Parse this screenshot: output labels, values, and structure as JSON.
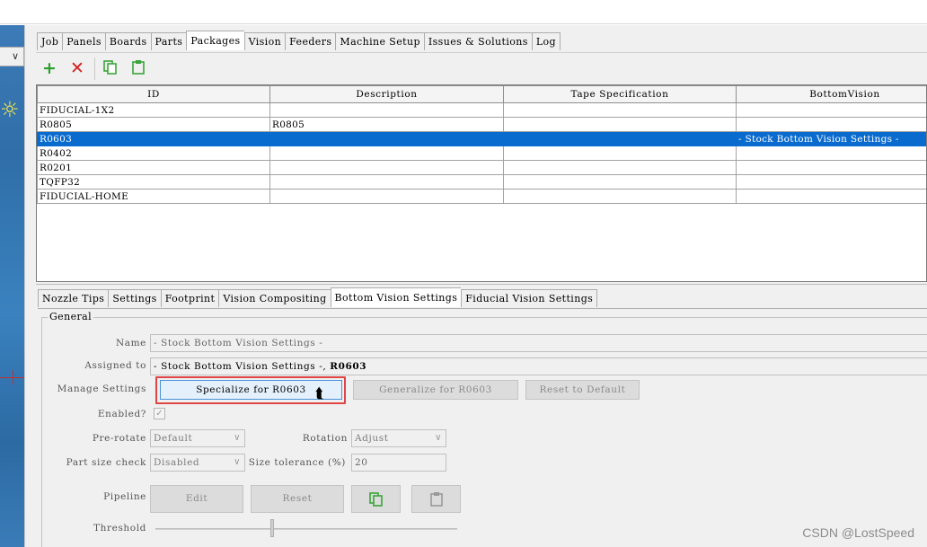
{
  "main_tabs": [
    "Job",
    "Panels",
    "Boards",
    "Parts",
    "Packages",
    "Vision",
    "Feeders",
    "Machine Setup",
    "Issues & Solutions",
    "Log"
  ],
  "active_main_tab": "Packages",
  "toolbar": {
    "add_icon": "plus-icon",
    "delete_icon": "delete-icon",
    "copy_icon": "copy-icon",
    "paste_icon": "paste-icon"
  },
  "table": {
    "columns": [
      "ID",
      "Description",
      "Tape Specification",
      "BottomVision"
    ],
    "rows": [
      [
        "FIDUCIAL-1X2",
        "",
        "",
        ""
      ],
      [
        "R0805",
        "R0805",
        "",
        ""
      ],
      [
        "R0603",
        "",
        "",
        "- Stock Bottom Vision Settings -"
      ],
      [
        "R0402",
        "",
        "",
        ""
      ],
      [
        "R0201",
        "",
        "",
        ""
      ],
      [
        "TQFP32",
        "",
        "",
        ""
      ],
      [
        "FIDUCIAL-HOME",
        "",
        "",
        ""
      ]
    ],
    "selected_row": "R0603"
  },
  "detail_tabs": [
    "Nozzle Tips",
    "Settings",
    "Footprint",
    "Vision Compositing",
    "Bottom Vision Settings",
    "Fiducial Vision Settings"
  ],
  "active_detail_tab": "Bottom Vision Settings",
  "general": {
    "title": "General",
    "name_label": "Name",
    "name_value": "- Stock Bottom Vision Settings -",
    "assigned_label": "Assigned to",
    "assigned_value": "- Stock Bottom Vision Settings -, ",
    "assigned_bold": "R0603",
    "manage_label": "Manage Settings",
    "specialize_btn": "Specialize for  R0603",
    "generalize_btn": "Generalize for R0603",
    "reset_default_btn": "Reset to Default",
    "enabled_label": "Enabled?",
    "prerotate_label": "Pre-rotate",
    "prerotate_value": "Default",
    "rotation_label": "Rotation",
    "rotation_value": "Adjust",
    "partsize_label": "Part size check",
    "partsize_value": "Disabled",
    "sizetol_label": "Size tolerance (%)",
    "sizetol_value": "20",
    "pipeline_label": "Pipeline",
    "edit_btn": "Edit",
    "reset_btn": "Reset",
    "threshold_label": "Threshold"
  },
  "watermark": "CSDN @LostSpeed"
}
